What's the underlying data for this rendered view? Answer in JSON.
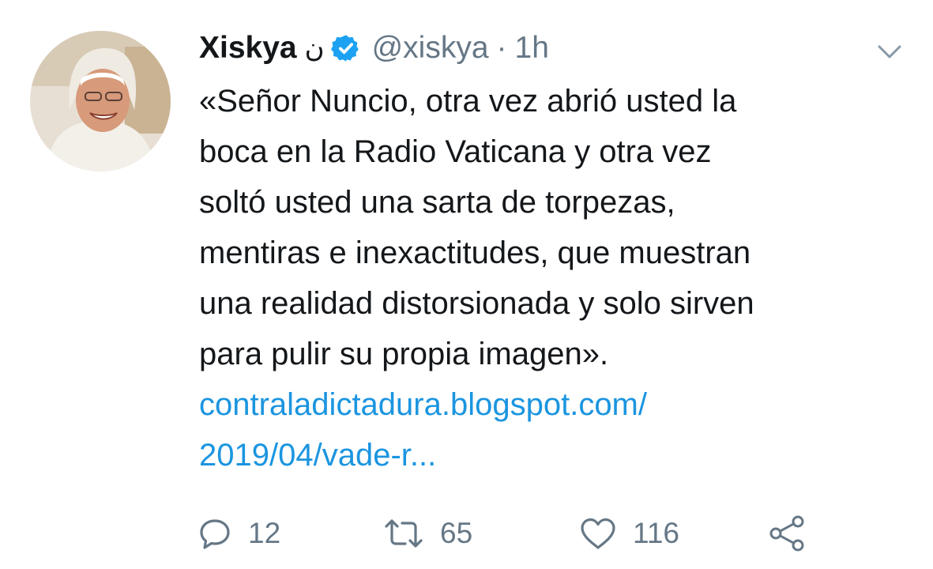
{
  "tweet": {
    "display_name": "Xiskya",
    "name_symbol": "ن",
    "handle": "@xiskya",
    "separator": "·",
    "time": "1h",
    "body_lines": [
      "«Señor Nuncio, otra vez abrió usted la",
      "boca en la Radio Vaticana y otra vez",
      "soltó usted una sarta de torpezas,",
      "mentiras e inexactitudes, que muestran",
      "una realidad distorsionada y solo sirven",
      "para pulir su propia imagen»."
    ],
    "link_lines": [
      "contraladictadura.blogspot.com/",
      "2019/04/vade-r..."
    ]
  },
  "actions": {
    "reply_count": "12",
    "retweet_count": "65",
    "like_count": "116"
  },
  "icons": {
    "verified": "verified-badge-icon",
    "caret": "chevron-down-icon",
    "reply": "reply-icon",
    "retweet": "retweet-icon",
    "like": "heart-icon",
    "share": "share-icon"
  },
  "colors": {
    "text": "#14171a",
    "secondary": "#657786",
    "link": "#1b95e0",
    "verified": "#1da1f2"
  }
}
